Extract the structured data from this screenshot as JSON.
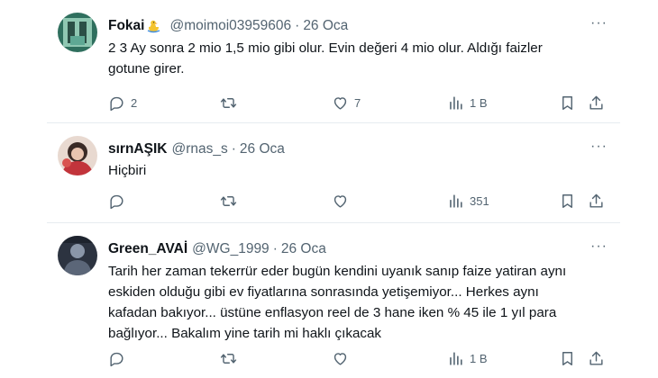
{
  "tweets": [
    {
      "name": "Fokai",
      "handle": "@moimoi03959606",
      "dot": "·",
      "time": "26 Oca",
      "lines": [
        "2 3 Ay sonra 2 mio 1,5 mio gibi olur.  Evin değeri 4 mio olur. Aldığı faizler",
        "gotune girer."
      ],
      "replies": "2",
      "retweets": "",
      "likes": "7",
      "views": "1 B",
      "more": "···"
    },
    {
      "name": "sırnAŞIK",
      "handle": "@rnas_s",
      "dot": "·",
      "time": "26 Oca",
      "lines": [
        "Hiçbiri"
      ],
      "replies": "",
      "retweets": "",
      "likes": "",
      "views": "351",
      "more": "···"
    },
    {
      "name": "Green_AVAİ",
      "handle": "@WG_1999",
      "dot": "·",
      "time": "26 Oca",
      "lines": [
        "Tarih her zaman tekerrür eder bugün kendini uyanık sanıp faize yatiran aynı",
        "eskiden olduğu gibi ev fiyatlarına sonrasında yetişemiyor... Herkes aynı",
        "kafadan bakıyor... üstüne enflasyon reel de 3 hane iken % 45 ile 1 yıl para",
        "bağlıyor... Bakalım yine tarih mi haklı çıkacak"
      ],
      "replies": "",
      "retweets": "",
      "likes": "",
      "views": "1 B",
      "more": "···"
    }
  ],
  "icons": {
    "reply": "reply-icon",
    "retweet": "retweet-icon",
    "like": "heart-icon",
    "views": "views-icon",
    "bookmark": "bookmark-icon",
    "share": "share-icon",
    "badge": "duck-emoji-icon"
  },
  "colors": {
    "muted": "#536471",
    "text": "#0f1419",
    "divider": "#e6ecf0"
  }
}
